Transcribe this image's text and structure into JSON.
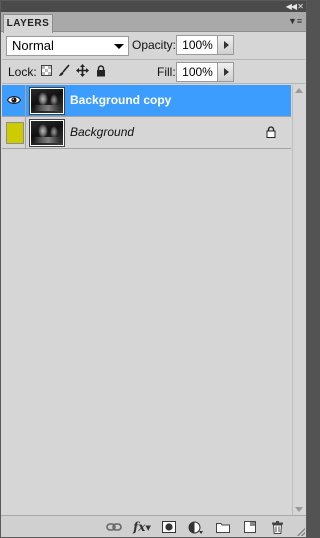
{
  "panel": {
    "tab_label": "LAYERS",
    "collapse_icon": "double-chevron-right-icon",
    "menu_icon": "panel-menu-icon"
  },
  "controls": {
    "blend_mode": "Normal",
    "opacity_label": "Opacity:",
    "opacity_value": "100%",
    "lock_label": "Lock:",
    "fill_label": "Fill:",
    "fill_value": "100%",
    "lock_icons": [
      "lock-transparent-pixels-icon",
      "lock-image-pixels-icon",
      "lock-position-icon",
      "lock-all-icon"
    ]
  },
  "layers": [
    {
      "name": "Background copy",
      "visible": true,
      "selected": true,
      "locked": false,
      "italic": false
    },
    {
      "name": "Background",
      "visible": false,
      "selected": false,
      "locked": true,
      "italic": true,
      "label_color": "#cccc00"
    }
  ],
  "footer_icons": [
    "link-layers-icon",
    "layer-style-fx-icon",
    "layer-mask-icon",
    "adjustment-layer-icon",
    "new-group-icon",
    "new-layer-icon",
    "delete-layer-icon"
  ],
  "colors": {
    "selection": "#3d9dff",
    "panel_bg": "#d6d6d6",
    "label_yellow": "#cccc00"
  }
}
